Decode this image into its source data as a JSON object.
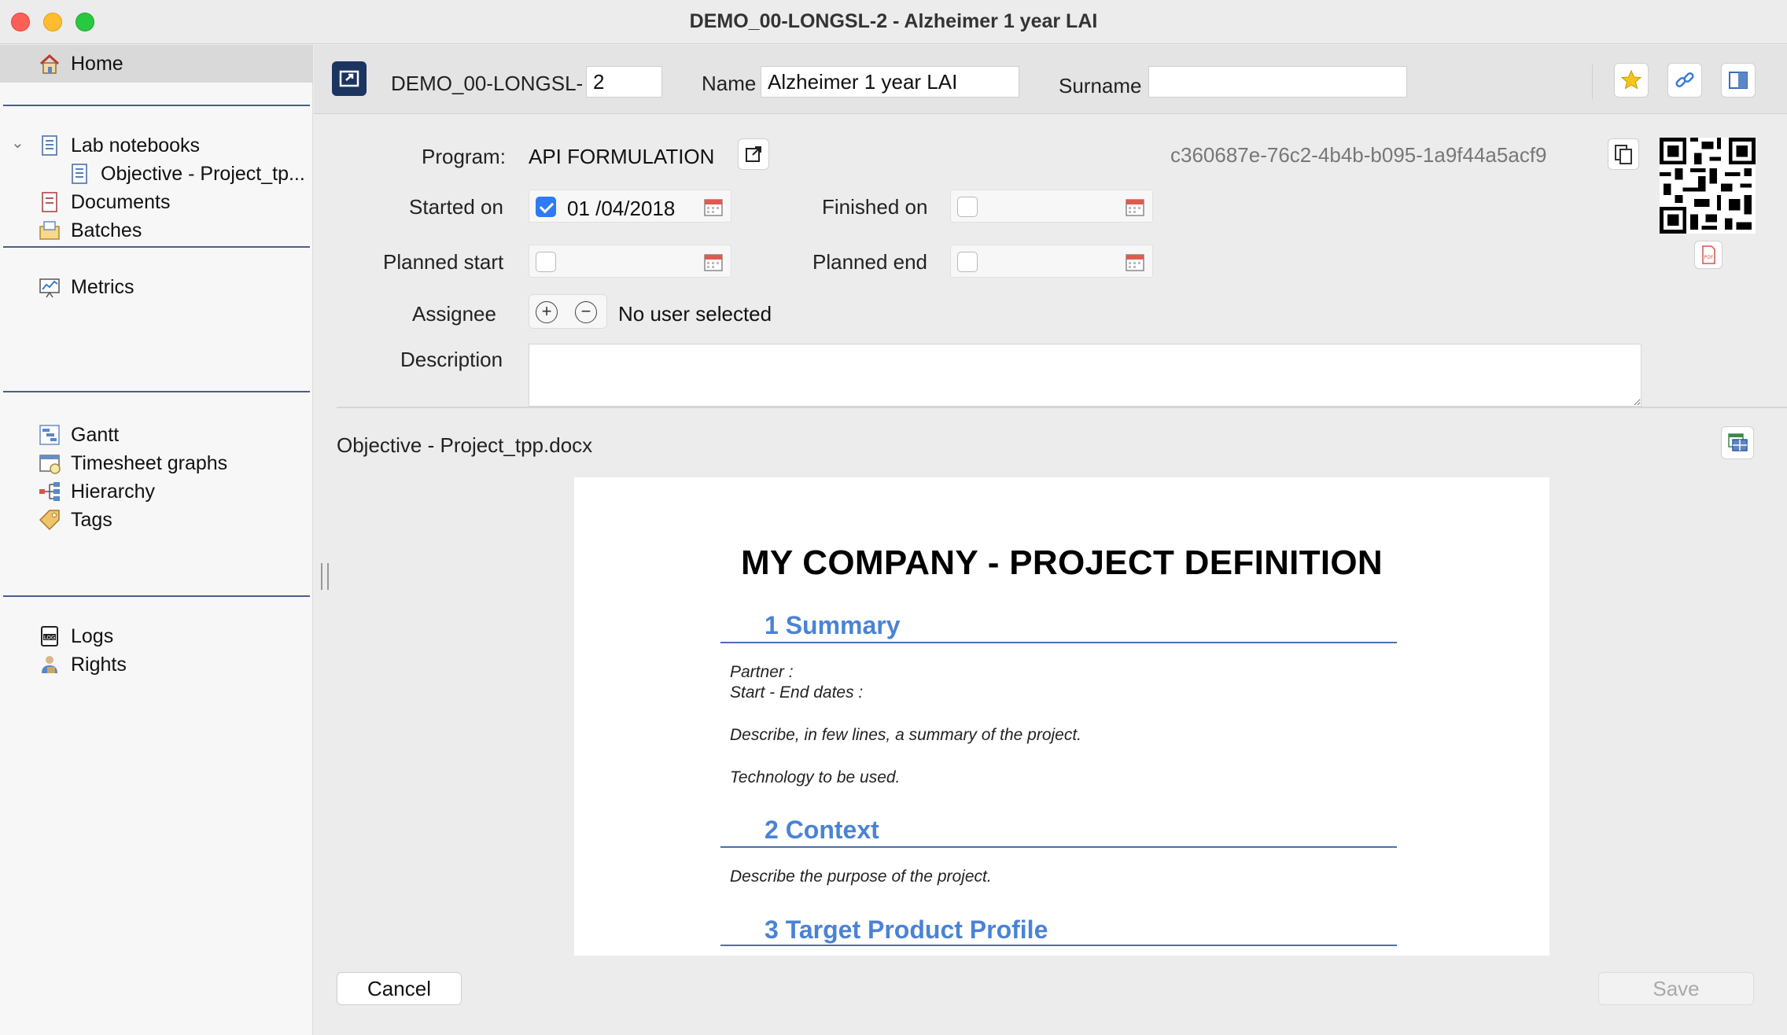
{
  "window": {
    "title": "DEMO_00-LONGSL-2 - Alzheimer 1 year LAI"
  },
  "sidebar": {
    "items": [
      {
        "label": "Home",
        "icon": "home-icon"
      },
      {
        "label": "Lab notebooks",
        "icon": "notebook-icon"
      },
      {
        "label": "Objective - Project_tp...",
        "icon": "document-icon"
      },
      {
        "label": "Documents",
        "icon": "documents-icon"
      },
      {
        "label": "Batches",
        "icon": "batches-icon"
      },
      {
        "label": "Metrics",
        "icon": "metrics-icon"
      },
      {
        "label": "Gantt",
        "icon": "gantt-icon"
      },
      {
        "label": "Timesheet graphs",
        "icon": "timesheet-icon"
      },
      {
        "label": "Hierarchy",
        "icon": "hierarchy-icon"
      },
      {
        "label": "Tags",
        "icon": "tag-icon"
      },
      {
        "label": "Logs",
        "icon": "logs-icon"
      },
      {
        "label": "Rights",
        "icon": "rights-icon"
      }
    ]
  },
  "header": {
    "code_prefix": "DEMO_00-LONGSL-",
    "code_value": "2",
    "name_label": "Name",
    "name_value": "Alzheimer 1 year LAI",
    "surname_label": "Surname",
    "surname_value": ""
  },
  "form": {
    "program_label": "Program:",
    "program_value": "API FORMULATION",
    "uuid": "c360687e-76c2-4b4b-b095-1a9f44a5acf9",
    "started_label": "Started on",
    "started_checked": true,
    "started_value": "01 /04/2018",
    "finished_label": "Finished on",
    "planned_start_label": "Planned start",
    "planned_end_label": "Planned end",
    "assignee_label": "Assignee",
    "assignee_value": "No user selected",
    "description_label": "Description",
    "plus": "+",
    "minus": "−"
  },
  "document": {
    "filename": "Objective - Project_tpp.docx",
    "heading": "MY COMPANY - PROJECT DEFINITION",
    "section1": "1 Summary",
    "s1_line1": "Partner :",
    "s1_line2": "Start - End dates :",
    "s1_line3": "Describe, in few lines, a summary of the project.",
    "s1_line4": "Technology to be used.",
    "section2": "2 Context",
    "s2_line1": "Describe the purpose of the project.",
    "section3": "3 Target Product Profile"
  },
  "footer": {
    "cancel_label": "Cancel",
    "save_label": "Save"
  },
  "colors": {
    "accent_blue": "#2f7bf5",
    "doc_heading_blue": "#4a83d4",
    "app_button_navy": "#1c3460"
  }
}
